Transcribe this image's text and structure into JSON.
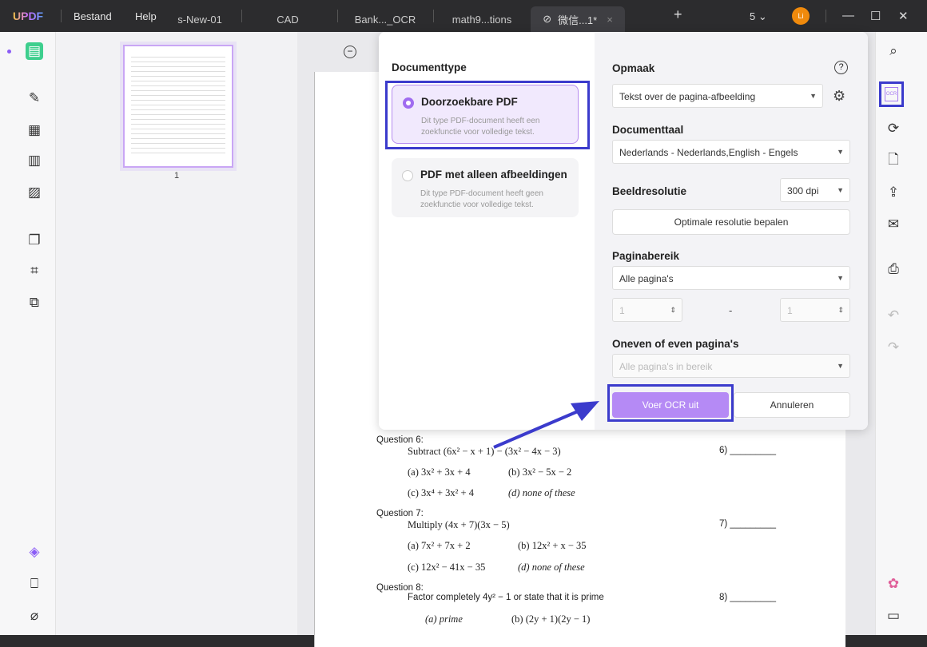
{
  "titlebar": {
    "logo": "UPDF",
    "menu": [
      "Bestand",
      "Help"
    ],
    "tabs": [
      "s-New-01",
      "CAD",
      "Bank..._OCR",
      "math9...tions",
      "微信...1*"
    ],
    "page_count": "5",
    "avatar": "Li"
  },
  "thumbnail": {
    "page_label": "1"
  },
  "ocr": {
    "doctype_heading": "Documenttype",
    "options": [
      {
        "title": "Doorzoekbare PDF",
        "desc": "Dit type PDF-document heeft een zoekfunctie voor volledige tekst.",
        "selected": true
      },
      {
        "title": "PDF met alleen afbeeldingen",
        "desc": "Dit type PDF-document heeft geen zoekfunctie voor volledige tekst.",
        "selected": false
      }
    ],
    "layout_label": "Opmaak",
    "layout_value": "Tekst over de pagina-afbeelding",
    "language_label": "Documenttaal",
    "language_value": "Nederlands - Nederlands,English - Engels",
    "resolution_label": "Beeldresolutie",
    "resolution_value": "300 dpi",
    "optimal_button": "Optimale resolutie bepalen",
    "range_label": "Paginabereik",
    "range_value": "Alle pagina's",
    "range_from": "1",
    "range_dash": "-",
    "range_to": "1",
    "oddeven_label": "Oneven of even pagina's",
    "oddeven_value": "Alle pagina's in bereik",
    "run_button": "Voer OCR uit",
    "cancel_button": "Annuleren"
  },
  "colors": {
    "accent": "#a77cf2",
    "highlight": "#3b3bcc"
  },
  "document": {
    "q6": {
      "label": "Question 6:",
      "text": "Subtract (6x² − x + 1) − (3x² − 4x − 3)",
      "num": "6) _________",
      "a": "(a)   3x² + 3x + 4",
      "b": "(b)   3x² − 5x − 2",
      "c": "(c)   3x⁴ + 3x² + 4",
      "d": "(d)   none of these"
    },
    "q7": {
      "label": "Question 7:",
      "text": "Multiply (4x + 7)(3x − 5)",
      "num": "7) _________",
      "a": "(a)     7x² + 7x + 2",
      "b": "(b)   12x² + x − 35",
      "c": "(c)   12x² − 41x − 35",
      "d": "(d)   none of these"
    },
    "q8": {
      "label": "Question 8:",
      "text": "Factor completely 4y² − 1 or state that it is prime",
      "num": "8) _________",
      "a": "(a)   prime",
      "b": "(b)   (2y + 1)(2y − 1)"
    }
  }
}
